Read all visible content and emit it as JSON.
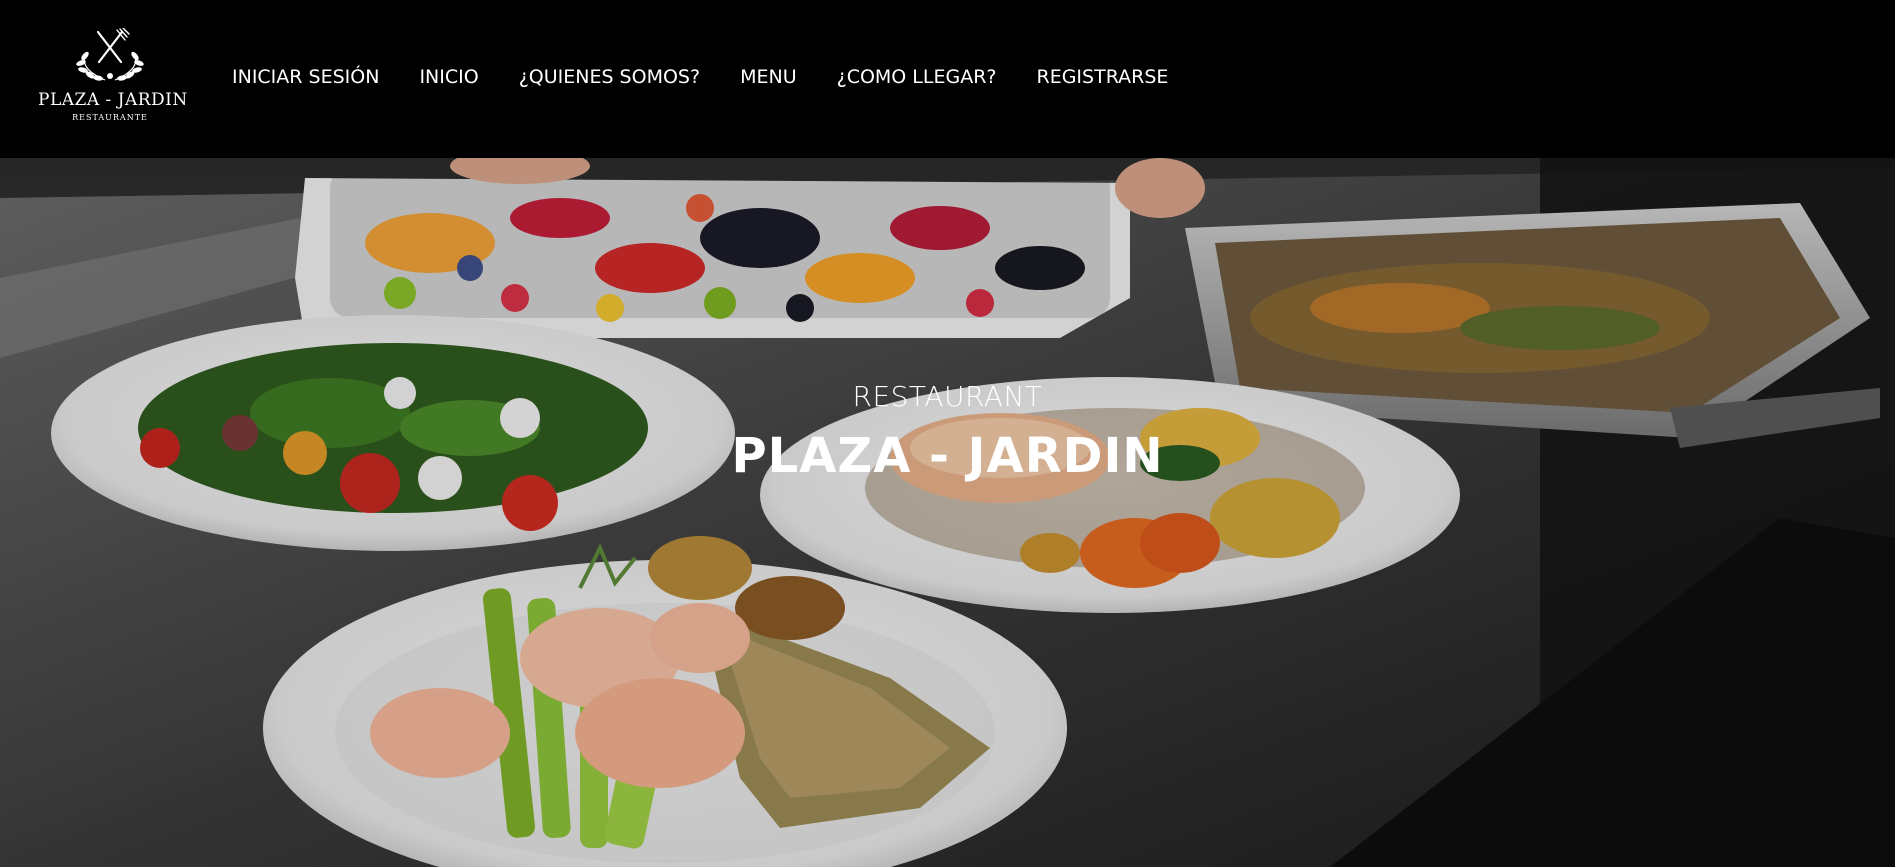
{
  "brand": {
    "name": "PLAZA - JARDIN",
    "subtitle": "RESTAURANTE",
    "icon": "crossed-fork-knife-laurel-icon"
  },
  "nav": {
    "items": [
      {
        "label": "INICIAR SESIÓN",
        "name": "nav-login"
      },
      {
        "label": "INICIO",
        "name": "nav-home"
      },
      {
        "label": "¿QUIENES SOMOS?",
        "name": "nav-about"
      },
      {
        "label": "MENU",
        "name": "nav-menu"
      },
      {
        "label": "¿COMO LLEGAR?",
        "name": "nav-directions"
      },
      {
        "label": "REGISTRARSE",
        "name": "nav-register"
      }
    ]
  },
  "hero": {
    "eyebrow": "RESTAURANT",
    "title": "PLAZA - JARDIN",
    "image": "plated-food-dishes-on-steel-counter"
  },
  "colors": {
    "header_bg": "#000000",
    "text": "#ffffff"
  }
}
